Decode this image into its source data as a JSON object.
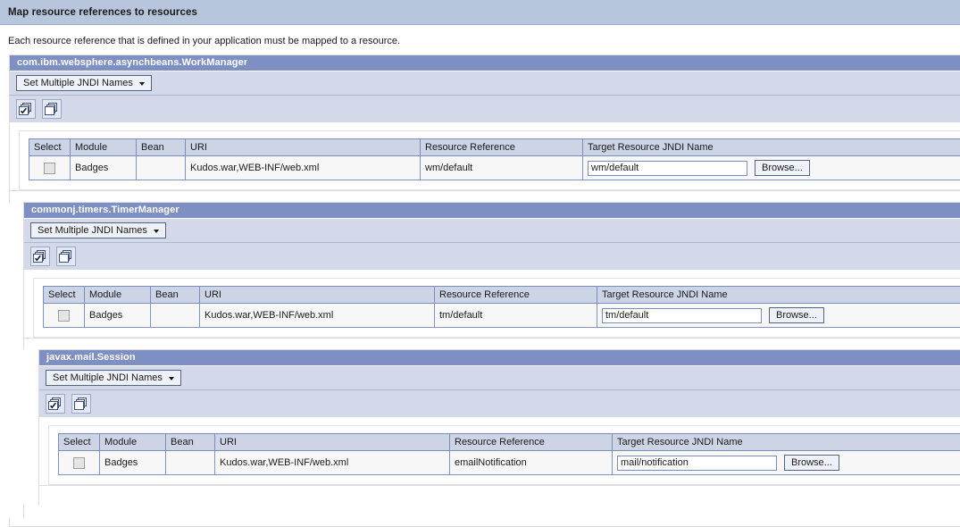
{
  "page": {
    "title": "Map resource references to resources",
    "description": "Each resource reference that is defined in your application must be mapped to a resource."
  },
  "labels": {
    "set_multiple_jndi": "Set Multiple JNDI Names",
    "browse": "Browse...",
    "select_all_icon": "select-all-icon",
    "deselect_all_icon": "deselect-all-icon"
  },
  "columns": [
    "Select",
    "Module",
    "Bean",
    "URI",
    "Resource Reference",
    "Target Resource JNDI Name"
  ],
  "groups": [
    {
      "title": "com.ibm.websphere.asynchbeans.WorkManager",
      "rows": [
        {
          "selected": false,
          "module": "Badges",
          "bean": "",
          "uri": "Kudos.war,WEB-INF/web.xml",
          "resource_reference": "wm/default",
          "jndi_name": "wm/default"
        }
      ]
    },
    {
      "title": "commonj.timers.TimerManager",
      "rows": [
        {
          "selected": false,
          "module": "Badges",
          "bean": "",
          "uri": "Kudos.war,WEB-INF/web.xml",
          "resource_reference": "tm/default",
          "jndi_name": "tm/default"
        }
      ]
    },
    {
      "title": "javax.mail.Session",
      "rows": [
        {
          "selected": false,
          "module": "Badges",
          "bean": "",
          "uri": "Kudos.war,WEB-INF/web.xml",
          "resource_reference": "emailNotification",
          "jndi_name": "mail/notification"
        }
      ]
    }
  ],
  "colors": {
    "header_bar": "#b8c6dd",
    "group_title": "#7e8fc4",
    "group_bar": "#d3d9e9",
    "table_header": "#ccd4e6",
    "row_bg": "#f7f7f7"
  }
}
